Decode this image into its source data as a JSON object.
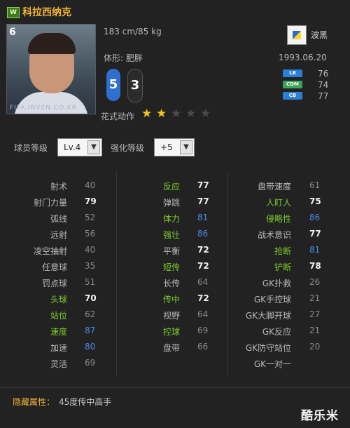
{
  "colors": {
    "accent_gold": "#f2b535",
    "stat_green": "#7fcc2a",
    "value_blue": "#4b8ae0",
    "background": "#222222"
  },
  "player": {
    "season_badge": "W",
    "name": "科拉西纳克",
    "number": "6",
    "photo_watermark": "FIFA.INVEN.CO.KR",
    "height_weight": "183 cm/85 kg",
    "nation": "波黑",
    "flag_icon": "bosnia-flag-icon",
    "birthdate": "1993.06.20",
    "body_type_label": "体形: 肥胖",
    "left_foot": "5",
    "right_foot": "3",
    "skill_moves_label": "花式动作",
    "skill_stars": 2,
    "skill_stars_max": 5,
    "positions": [
      {
        "pos": "LB",
        "rating": "76",
        "color": "#2a7fd4"
      },
      {
        "pos": "CDM",
        "rating": "74",
        "color": "#3aa35a"
      },
      {
        "pos": "CB",
        "rating": "77",
        "color": "#2a7fd4"
      }
    ]
  },
  "controls": {
    "player_level_label": "球员等级",
    "player_level_value": "Lv.4",
    "enhance_level_label": "强化等级",
    "enhance_level_value": "+5"
  },
  "stats": {
    "col1": [
      {
        "label": "射术",
        "value": "40",
        "highlight": false,
        "tone": "grey"
      },
      {
        "label": "射门力量",
        "value": "79",
        "highlight": false,
        "tone": "white"
      },
      {
        "label": "弧线",
        "value": "52",
        "highlight": false,
        "tone": "grey"
      },
      {
        "label": "远射",
        "value": "56",
        "highlight": false,
        "tone": "grey"
      },
      {
        "label": "凌空抽射",
        "value": "40",
        "highlight": false,
        "tone": "grey"
      },
      {
        "label": "任意球",
        "value": "35",
        "highlight": false,
        "tone": "grey"
      },
      {
        "label": "罚点球",
        "value": "51",
        "highlight": false,
        "tone": "grey"
      },
      {
        "label": "头球",
        "value": "70",
        "highlight": true,
        "tone": "white"
      },
      {
        "label": "站位",
        "value": "62",
        "highlight": true,
        "tone": "grey"
      },
      {
        "label": "速度",
        "value": "87",
        "highlight": true,
        "tone": "blue"
      },
      {
        "label": "加速",
        "value": "80",
        "highlight": false,
        "tone": "blue"
      },
      {
        "label": "灵活",
        "value": "69",
        "highlight": false,
        "tone": "grey"
      }
    ],
    "col2": [
      {
        "label": "反应",
        "value": "77",
        "highlight": true,
        "tone": "white"
      },
      {
        "label": "弹跳",
        "value": "77",
        "highlight": false,
        "tone": "white"
      },
      {
        "label": "体力",
        "value": "81",
        "highlight": true,
        "tone": "blue"
      },
      {
        "label": "强壮",
        "value": "86",
        "highlight": true,
        "tone": "blue"
      },
      {
        "label": "平衡",
        "value": "72",
        "highlight": false,
        "tone": "white"
      },
      {
        "label": "短传",
        "value": "72",
        "highlight": true,
        "tone": "white"
      },
      {
        "label": "长传",
        "value": "64",
        "highlight": false,
        "tone": "grey"
      },
      {
        "label": "传中",
        "value": "72",
        "highlight": true,
        "tone": "white"
      },
      {
        "label": "视野",
        "value": "64",
        "highlight": false,
        "tone": "grey"
      },
      {
        "label": "控球",
        "value": "69",
        "highlight": true,
        "tone": "grey"
      },
      {
        "label": "盘带",
        "value": "66",
        "highlight": false,
        "tone": "grey"
      }
    ],
    "col3": [
      {
        "label": "盘带速度",
        "value": "61",
        "highlight": false,
        "tone": "grey"
      },
      {
        "label": "人盯人",
        "value": "75",
        "highlight": true,
        "tone": "white"
      },
      {
        "label": "侵略性",
        "value": "86",
        "highlight": true,
        "tone": "blue"
      },
      {
        "label": "战术意识",
        "value": "77",
        "highlight": false,
        "tone": "white"
      },
      {
        "label": "抢断",
        "value": "81",
        "highlight": true,
        "tone": "blue"
      },
      {
        "label": "铲断",
        "value": "78",
        "highlight": true,
        "tone": "white"
      },
      {
        "label": "GK扑救",
        "value": "26",
        "highlight": false,
        "tone": "grey"
      },
      {
        "label": "GK手控球",
        "value": "21",
        "highlight": false,
        "tone": "grey"
      },
      {
        "label": "GK大脚开球",
        "value": "27",
        "highlight": false,
        "tone": "grey"
      },
      {
        "label": "GK反应",
        "value": "21",
        "highlight": false,
        "tone": "grey"
      },
      {
        "label": "GK防守站位",
        "value": "20",
        "highlight": false,
        "tone": "grey"
      },
      {
        "label": "GK一对一",
        "value": "",
        "highlight": false,
        "tone": "grey"
      }
    ]
  },
  "hidden": {
    "label": "隐藏属性：",
    "value": "45度传中高手"
  },
  "site_logo": "酷乐米"
}
